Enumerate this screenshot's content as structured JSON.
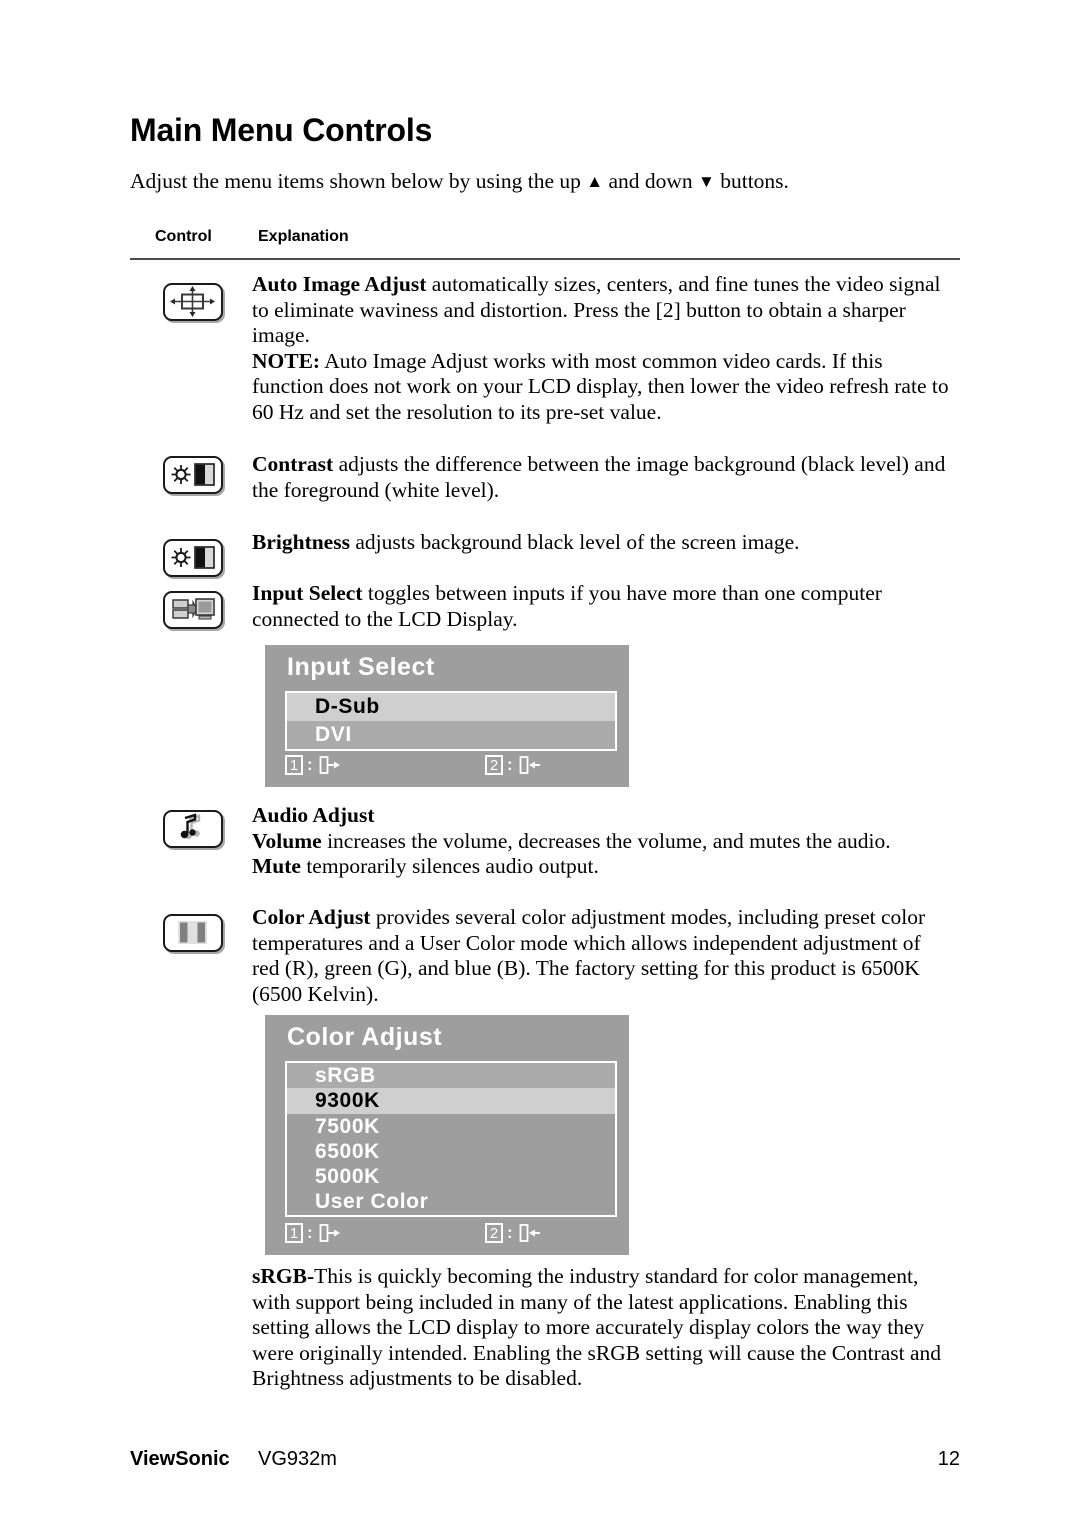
{
  "document": {
    "title": "Main Menu Controls",
    "intro_before": "Adjust the menu items shown below by using the up ",
    "intro_up_glyph": "▲",
    "intro_middle": " and down ",
    "intro_down_glyph": "▼",
    "intro_after": " buttons."
  },
  "table": {
    "header": {
      "control": "Control",
      "explanation": "Explanation"
    },
    "rows": [
      {
        "icon": "auto-image-adjust-icon",
        "term": "Auto Image Adjust",
        "body": " automatically sizes, centers, and fine tunes the video signal to eliminate waviness and distortion. Press the [2] button to obtain a sharper image.",
        "note_label": "NOTE:",
        "note_body": " Auto Image Adjust works with most common video cards. If this function does not work on your LCD display, then lower the video refresh rate to 60 Hz and set the resolution to its pre-set value."
      },
      {
        "icon": "contrast-icon",
        "term": "Contrast",
        "body": " adjusts the difference between the image background  (black level) and the foreground (white level)."
      },
      {
        "icon": "brightness-icon",
        "term": "Brightness",
        "body": " adjusts background black level of the screen image."
      },
      {
        "icon": "input-select-icon",
        "term": "Input Select",
        "body": " toggles between inputs if you have more than one computer connected to the LCD Display."
      },
      {
        "icon": "audio-adjust-icon",
        "term": "Audio Adjust",
        "term2": "Volume",
        "body2": " increases the volume, decreases the volume, and mutes the audio.",
        "term3": "Mute",
        "body3": " temporarily silences audio output."
      },
      {
        "icon": "color-adjust-icon",
        "term": "Color Adjust",
        "body": " provides several color adjustment modes, including preset color temperatures and a User Color mode which allows independent adjustment of red (R), green (G), and blue (B). The factory setting for this product is 6500K (6500 Kelvin)."
      }
    ]
  },
  "osd_input_select": {
    "title": "Input Select",
    "items": [
      {
        "label": "D-Sub",
        "selected": true
      },
      {
        "label": "DVI",
        "selected": false
      }
    ],
    "footer": {
      "key1": "1",
      "key1_colon": ":",
      "key1_icon": "exit-arrow-icon",
      "key2": "2",
      "key2_colon": ":",
      "key2_icon": "enter-arrow-icon"
    },
    "colors": {
      "background": "#9e9e9e",
      "row_alt": "#ababab",
      "selected": "#cfcfcf",
      "text": "#ffffff"
    }
  },
  "osd_color_adjust": {
    "title": "Color Adjust",
    "items": [
      {
        "label": "sRGB",
        "selected": false
      },
      {
        "label": "9300K",
        "selected": true
      },
      {
        "label": "7500K",
        "selected": false
      },
      {
        "label": "6500K",
        "selected": false
      },
      {
        "label": "5000K",
        "selected": false
      },
      {
        "label": "User Color",
        "selected": false
      }
    ],
    "footer": {
      "key1": "1",
      "key1_colon": ":",
      "key1_icon": "exit-arrow-icon",
      "key2": "2",
      "key2_colon": ":",
      "key2_icon": "enter-arrow-icon"
    },
    "colors": {
      "background": "#9e9e9e",
      "row_alt": "#ababab",
      "selected": "#cfcfcf",
      "text": "#ffffff"
    }
  },
  "srgb_paragraph": {
    "term": "sRGB-",
    "body": "This is quickly becoming the industry standard for color management, with support being included in many of the latest applications. Enabling this setting allows the LCD display to more accurately display colors the way they were originally intended. Enabling the sRGB setting will cause the Contrast and Brightness adjustments to be disabled."
  },
  "footer": {
    "brand": "ViewSonic",
    "model": "VG932m",
    "page_number": "12"
  }
}
